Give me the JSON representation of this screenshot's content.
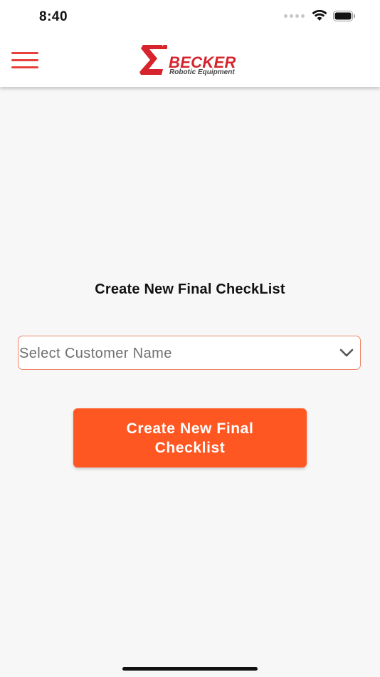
{
  "status_bar": {
    "time": "8:40",
    "icons": [
      "cellular-signal-icon",
      "wifi-icon",
      "battery-icon"
    ]
  },
  "header": {
    "menu_icon": "hamburger-menu-icon",
    "logo": {
      "brand": "BECKER",
      "tagline": "Robotic Equipment"
    }
  },
  "main": {
    "title": "Create New Final CheckList",
    "customer_select": {
      "placeholder": "Select Customer Name",
      "icon": "chevron-down-icon"
    },
    "create_button_label": "Create New Final Checklist"
  },
  "colors": {
    "accent": "#ff5722",
    "brand_red": "#d6232c",
    "menu_red": "#e8403a",
    "select_border": "#f0856a",
    "background": "#f7f7f7"
  }
}
